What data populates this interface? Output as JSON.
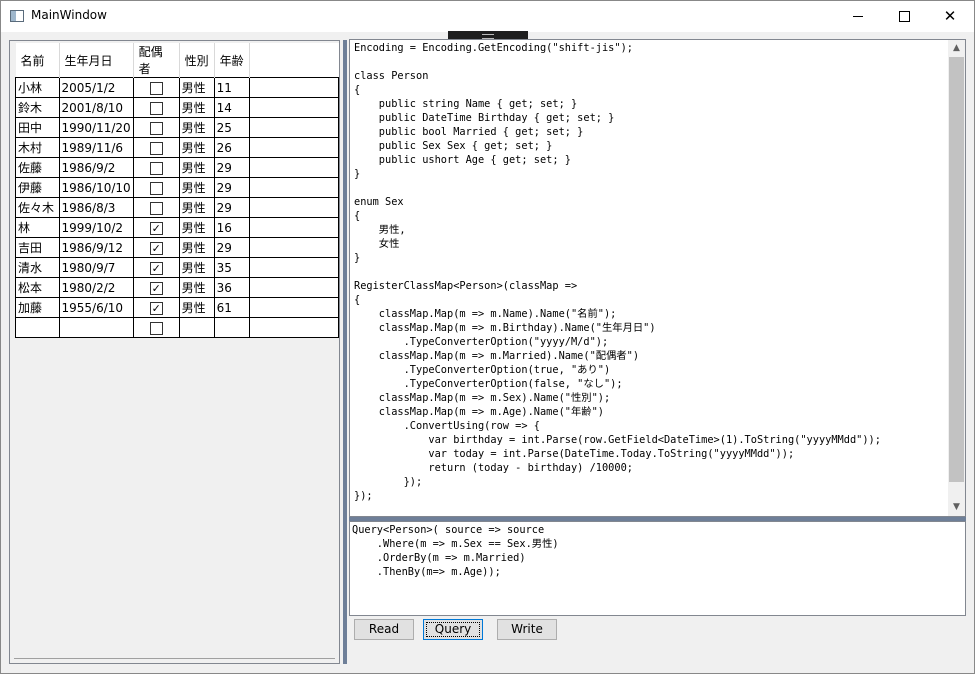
{
  "window": {
    "title": "MainWindow"
  },
  "icons": {
    "app": "app-window-icon",
    "minimize": "minimize-icon",
    "maximize": "maximize-icon",
    "close": "close-icon",
    "check": "checkmark-icon"
  },
  "grid": {
    "columns": [
      "名前",
      "生年月日",
      "配偶者",
      "性別",
      "年齢"
    ],
    "rows": [
      {
        "name": "小林",
        "birthday": "2005/1/2",
        "married": false,
        "sex": "男性",
        "age": "11"
      },
      {
        "name": "鈴木",
        "birthday": "2001/8/10",
        "married": false,
        "sex": "男性",
        "age": "14"
      },
      {
        "name": "田中",
        "birthday": "1990/11/20",
        "married": false,
        "sex": "男性",
        "age": "25"
      },
      {
        "name": "木村",
        "birthday": "1989/11/6",
        "married": false,
        "sex": "男性",
        "age": "26"
      },
      {
        "name": "佐藤",
        "birthday": "1986/9/2",
        "married": false,
        "sex": "男性",
        "age": "29"
      },
      {
        "name": "伊藤",
        "birthday": "1986/10/10",
        "married": false,
        "sex": "男性",
        "age": "29"
      },
      {
        "name": "佐々木",
        "birthday": "1986/8/3",
        "married": false,
        "sex": "男性",
        "age": "29"
      },
      {
        "name": "林",
        "birthday": "1999/10/2",
        "married": true,
        "sex": "男性",
        "age": "16"
      },
      {
        "name": "吉田",
        "birthday": "1986/9/12",
        "married": true,
        "sex": "男性",
        "age": "29"
      },
      {
        "name": "清水",
        "birthday": "1980/9/7",
        "married": true,
        "sex": "男性",
        "age": "35"
      },
      {
        "name": "松本",
        "birthday": "1980/2/2",
        "married": true,
        "sex": "男性",
        "age": "36"
      },
      {
        "name": "加藤",
        "birthday": "1955/6/10",
        "married": true,
        "sex": "男性",
        "age": "61"
      },
      {
        "name": "",
        "birthday": "",
        "married": false,
        "sex": "",
        "age": ""
      }
    ]
  },
  "code_editor": {
    "text": "Encoding = Encoding.GetEncoding(\"shift-jis\");\n\nclass Person\n{\n    public string Name { get; set; }\n    public DateTime Birthday { get; set; }\n    public bool Married { get; set; }\n    public Sex Sex { get; set; }\n    public ushort Age { get; set; }\n}\n\nenum Sex\n{\n    男性,\n    女性\n}\n\nRegisterClassMap<Person>(classMap =>\n{\n    classMap.Map(m => m.Name).Name(\"名前\");\n    classMap.Map(m => m.Birthday).Name(\"生年月日\")\n        .TypeConverterOption(\"yyyy/M/d\");\n    classMap.Map(m => m.Married).Name(\"配偶者\")\n        .TypeConverterOption(true, \"あり\")\n        .TypeConverterOption(false, \"なし\");\n    classMap.Map(m => m.Sex).Name(\"性別\");\n    classMap.Map(m => m.Age).Name(\"年齢\")\n        .ConvertUsing(row => {\n            var birthday = int.Parse(row.GetField<DateTime>(1).ToString(\"yyyyMMdd\"));\n            var today = int.Parse(DateTime.Today.ToString(\"yyyyMMdd\"));\n            return (today - birthday) /10000;\n        });\n});"
  },
  "query_editor": {
    "text": "Query<Person>( source => source\n    .Where(m => m.Sex == Sex.男性)\n    .OrderBy(m => m.Married)\n    .ThenBy(m=> m.Age));"
  },
  "buttons": {
    "read": "Read",
    "query": "Query",
    "write": "Write"
  },
  "colors": {
    "splitter": "#6e7f98",
    "focus": "#0078d7"
  }
}
